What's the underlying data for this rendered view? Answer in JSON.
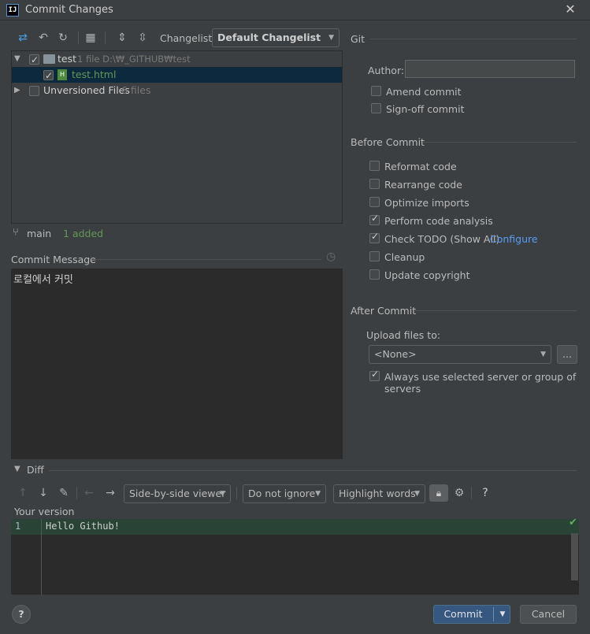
{
  "window": {
    "title": "Commit Changes",
    "logo_text": "IJ"
  },
  "toolbar": {
    "changelist_label": "Changelist:",
    "changelist_value": "Default Changelist"
  },
  "tree": {
    "root": {
      "name": "test",
      "meta": "1 file  D:\\₩_GITHUB₩test"
    },
    "file": {
      "name": "test.html"
    },
    "unversioned": {
      "name": "Unversioned Files",
      "meta": "6 files"
    }
  },
  "status": {
    "branch": "main",
    "added": "1 added"
  },
  "commit_message": {
    "label": "Commit Message",
    "value": "로컬에서 커밋"
  },
  "git": {
    "section": "Git",
    "author_label": "Author:",
    "author_value": "",
    "amend": "Amend commit",
    "signoff": "Sign-off commit"
  },
  "before_commit": {
    "section": "Before Commit",
    "items": [
      {
        "label": "Reformat code",
        "checked": false
      },
      {
        "label": "Rearrange code",
        "checked": false
      },
      {
        "label": "Optimize imports",
        "checked": false
      },
      {
        "label": "Perform code analysis",
        "checked": true
      },
      {
        "label": "Check TODO (Show All)",
        "checked": true,
        "link": "Configure"
      },
      {
        "label": "Cleanup",
        "checked": false
      },
      {
        "label": "Update copyright",
        "checked": false
      }
    ]
  },
  "after_commit": {
    "section": "After Commit",
    "upload_label": "Upload files to:",
    "upload_value": "<None>",
    "browse": "...",
    "always_use": "Always use selected server or group of servers"
  },
  "diff": {
    "section": "Diff",
    "viewer": "Side-by-side viewer",
    "ignore": "Do not ignore",
    "highlight": "Highlight words",
    "help": "?",
    "your_version": "Your version",
    "line_no": "1",
    "line_text": "Hello Github!"
  },
  "footer": {
    "help": "?",
    "commit": "Commit",
    "cancel": "Cancel"
  },
  "colors": {
    "accent": "#365880",
    "link": "#589df6",
    "added": "#629755",
    "diff_line": "#294436"
  }
}
